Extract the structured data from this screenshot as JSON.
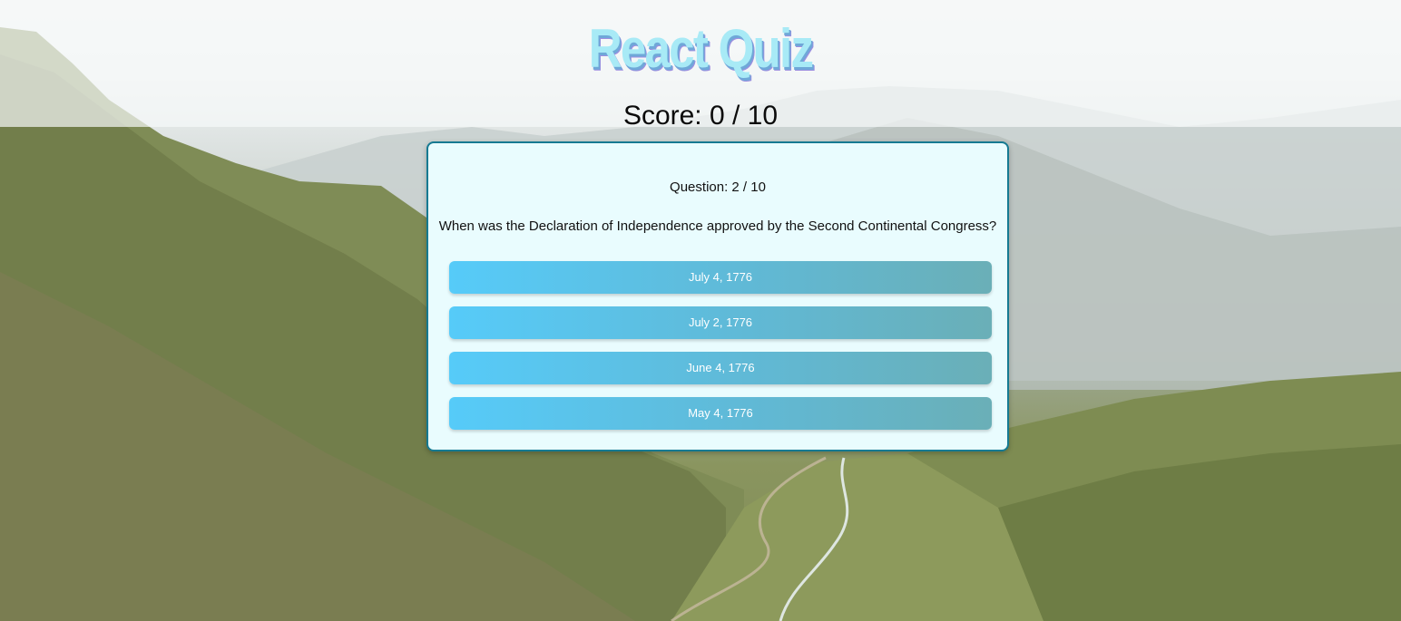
{
  "app": {
    "title": "React Quiz"
  },
  "score": {
    "text": "Score: 0 / 10"
  },
  "quiz": {
    "question_number": "Question: 2 / 10",
    "question": "When was the Declaration of Independence approved by the Second Continental Congress?",
    "answers": [
      {
        "label": "July 4, 1776"
      },
      {
        "label": "July 2, 1776"
      },
      {
        "label": "June 4, 1776"
      },
      {
        "label": "May 4, 1776"
      }
    ]
  },
  "colors": {
    "card_background": "#e9fcfe",
    "card_border": "#167a92",
    "button_gradient_start": "#56cbf9",
    "button_gradient_end": "#6aafb7",
    "title_color": "#a8eaf6"
  }
}
